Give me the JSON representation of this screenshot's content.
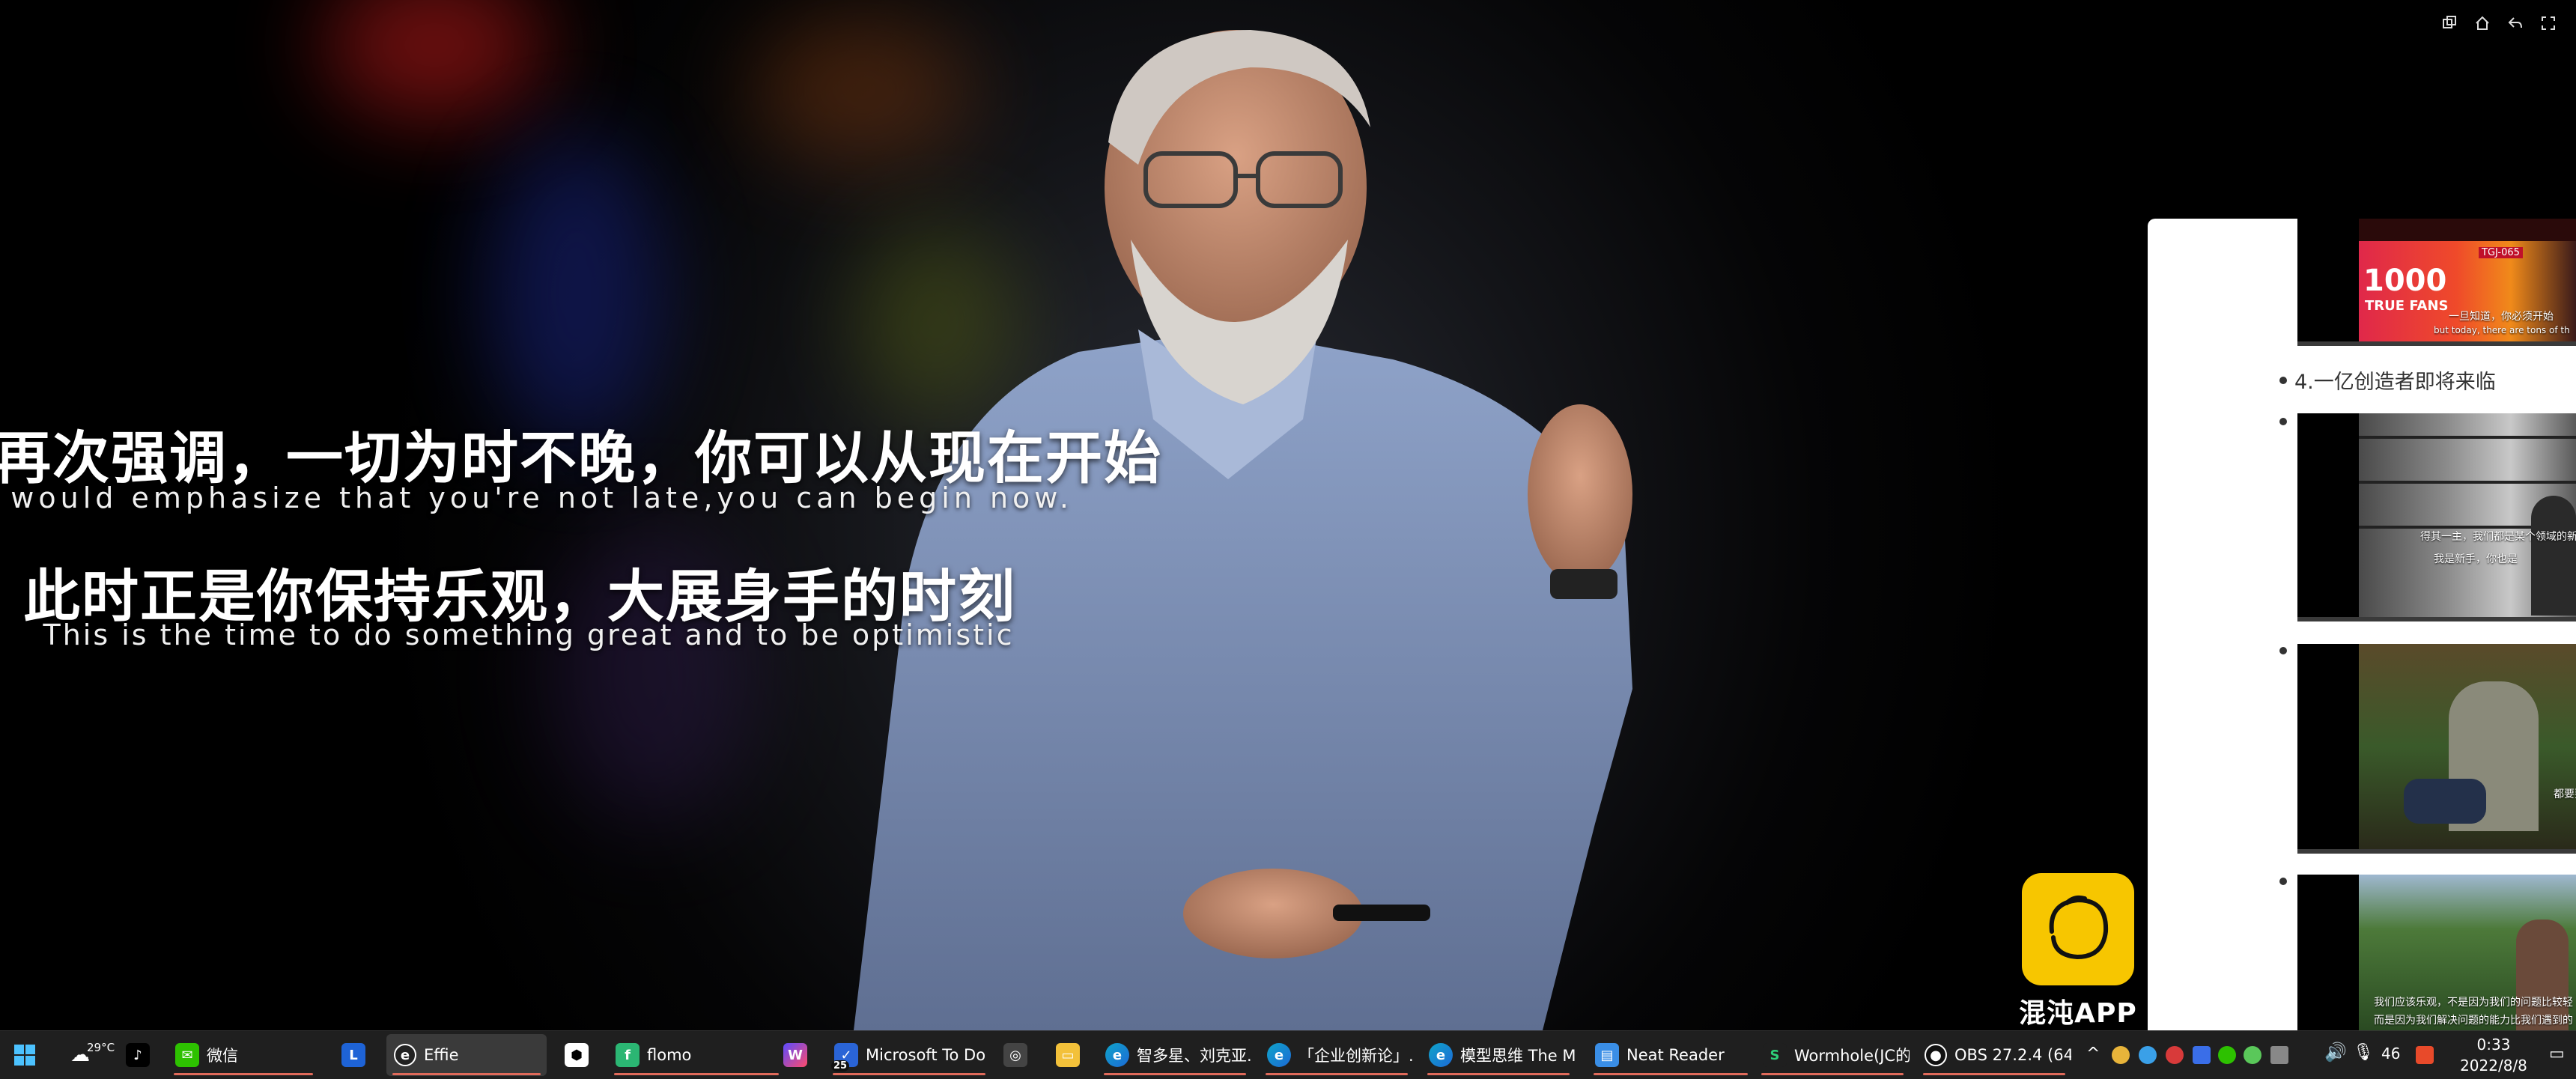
{
  "subtitles": {
    "zh_line1": "我想再次强调，一切为时不晚，你可以从现在开始",
    "en_line1": "I would emphasize that you're not late,you can begin now.",
    "zh_line2": "此时正是你保持乐观，大展身手的时刻",
    "en_line2": "This is the time to do something great and to be optimistic"
  },
  "side_panel": {
    "heading_4": "4.一亿创造者即将来临",
    "thumbnails": [
      {
        "title_big": "1000",
        "title_small": "TRUE FANS",
        "tag": "TGJ-065",
        "caption": "一旦知道，你必须开始",
        "caption2": "but today, there are tons of th"
      },
      {
        "caption": "得其一主，我们都是某个领域的新手",
        "caption2": "我是新手，你也是"
      },
      {
        "caption": "都要要"
      },
      {
        "caption": "我们应该乐观，不是因为我们的问题比较轻",
        "caption2": "而是因为我们解决问题的能力比我们遇到的"
      }
    ]
  },
  "app_badge": {
    "name": "混沌APP"
  },
  "taskbar": {
    "weather": "29°C",
    "items": [
      {
        "label": "微信"
      },
      {
        "label": "Effie"
      },
      {
        "label": "flomo"
      },
      {
        "label": "Microsoft To Do",
        "badge": "25"
      },
      {
        "label": "智多星、刘克亚..."
      },
      {
        "label": "「企业创新论」..."
      },
      {
        "label": "模型思维 The M..."
      },
      {
        "label": "Neat Reader"
      },
      {
        "label": "Wormhole(JC的..."
      },
      {
        "label": "OBS 27.2.4 (64-..."
      }
    ],
    "time": "0:33",
    "date": "2022/8/8",
    "notification_count": "46",
    "brand_accent": "#e06a5a"
  }
}
